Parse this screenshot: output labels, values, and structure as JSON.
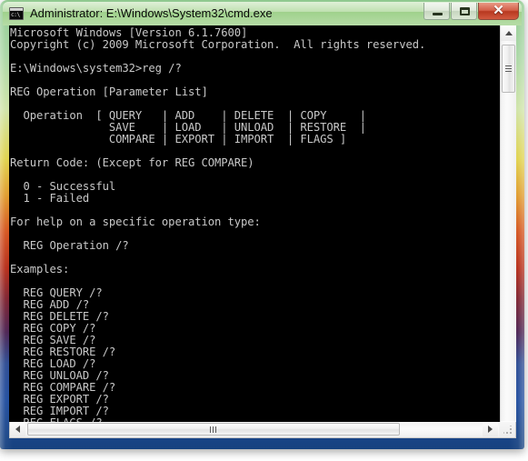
{
  "window": {
    "title": "Administrator: E:\\Windows\\System32\\cmd.exe",
    "icon_label": "c:\\",
    "buttons": {
      "minimize": "minimize",
      "maximize": "maximize",
      "close": "✕"
    },
    "frame_colors": {
      "top": "#8fc98f",
      "yellow": "#e0d24a",
      "orange": "#d4521c",
      "red": "#b52a16",
      "purple": "#4a2050",
      "blue": "#1f4c9e"
    },
    "titlebar_color": "#bfe0b0",
    "close_color": "#b83820"
  },
  "console": {
    "background": "#000000",
    "foreground": "#c8c8c8",
    "lines": [
      "Microsoft Windows [Version 6.1.7600]",
      "Copyright (c) 2009 Microsoft Corporation.  All rights reserved.",
      "",
      "E:\\Windows\\system32>reg /?",
      "",
      "REG Operation [Parameter List]",
      "",
      "  Operation  [ QUERY   | ADD    | DELETE  | COPY     |",
      "               SAVE    | LOAD   | UNLOAD  | RESTORE  |",
      "               COMPARE | EXPORT | IMPORT  | FLAGS ]",
      "",
      "Return Code: (Except for REG COMPARE)",
      "",
      "  0 - Successful",
      "  1 - Failed",
      "",
      "For help on a specific operation type:",
      "",
      "  REG Operation /?",
      "",
      "Examples:",
      "",
      "  REG QUERY /?",
      "  REG ADD /?",
      "  REG DELETE /?",
      "  REG COPY /?",
      "  REG SAVE /?",
      "  REG RESTORE /?",
      "  REG LOAD /?",
      "  REG UNLOAD /?",
      "  REG COMPARE /?",
      "  REG EXPORT /?",
      "  REG IMPORT /?",
      "  REG FLAGS /?",
      ""
    ],
    "prompt": "E:\\Windows\\system32>"
  },
  "scrollbars": {
    "vertical": {
      "up_arrow": "▲",
      "down_arrow": "▼",
      "thumb": "vertical-thumb"
    },
    "horizontal": {
      "left_arrow": "◀",
      "right_arrow": "▶",
      "thumb": "horizontal-thumb"
    },
    "resize_grip": "resize-grip"
  }
}
